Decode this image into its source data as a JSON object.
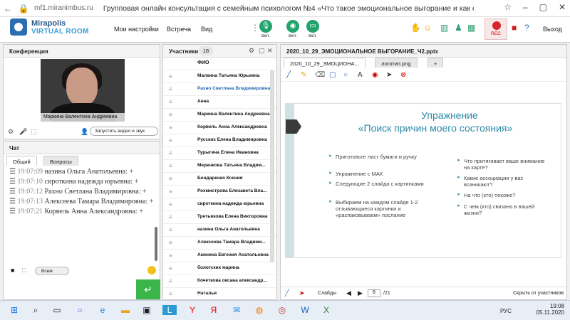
{
  "browser": {
    "url": "mf1.miranimbus.ru",
    "tab_title": "Групповая онлайн консультация с семейным психологом №4 «Что такое эмоциональное выгорание и как е..."
  },
  "app": {
    "logo_line1": "Mirapolis",
    "logo_line2": "VIRTUAL ROOM",
    "menu": [
      "Мои настройки",
      "Встреча",
      "Вид"
    ],
    "toggle_labels": [
      "вкл.",
      "вкл.",
      "вкл."
    ],
    "rec_label": "REC",
    "exit_label": "Выход"
  },
  "conference": {
    "title": "Конференция",
    "presenter_name": "Маркина Валентина Андреевна",
    "start_video_label": "Запустить видео и звук"
  },
  "chat": {
    "title": "Чат",
    "tabs": [
      "Общий",
      "Вопросы"
    ],
    "messages": [
      {
        "time": "19:07:09",
        "text": "назина Ольга Анатольевна: +"
      },
      {
        "time": "19:07:10",
        "text": "сироткина надежда юрьевна: +"
      },
      {
        "time": "19:07:12",
        "text": "Рахно Светлана Владимировна: +"
      },
      {
        "time": "19:07:13",
        "text": "Алексеева Тамара Владимировна: +"
      },
      {
        "time": "19:07:21",
        "text": "Корвель Анна Александровна: +"
      }
    ],
    "recipient": "Всем"
  },
  "participants": {
    "title": "Участники",
    "count": "18",
    "column_header": "ФИО",
    "list": [
      {
        "name": "Малкина Татьяна Юрьевна",
        "highlight": false
      },
      {
        "name": "Рахно Светлана Владимировна",
        "highlight": true
      },
      {
        "name": "Анна",
        "highlight": false
      },
      {
        "name": "Маркина Валентина Андреевна",
        "highlight": false
      },
      {
        "name": "Корвель Анна Александровна",
        "highlight": false
      },
      {
        "name": "Русских Елена Владимировна",
        "highlight": false
      },
      {
        "name": "Турыгина Елена Ивановна",
        "highlight": false
      },
      {
        "name": "Меренкова Татьяна Владим...",
        "highlight": false
      },
      {
        "name": "Бондаренко Ксения",
        "highlight": false
      },
      {
        "name": "Рохмистрова Елизавета Вла...",
        "highlight": false
      },
      {
        "name": "сироткина надежда юрьевна",
        "highlight": false
      },
      {
        "name": "Третьякова Елена Викторовна",
        "highlight": false
      },
      {
        "name": "назина Ольга Анатольевна",
        "highlight": false
      },
      {
        "name": "Алексеева Тамара Владими...",
        "highlight": false
      },
      {
        "name": "Акинина Евгения Анатольевна",
        "highlight": false
      },
      {
        "name": "болотских марина",
        "highlight": false
      },
      {
        "name": "Кочеткова оксана александр...",
        "highlight": false
      },
      {
        "name": "Наталья",
        "highlight": false
      }
    ]
  },
  "presentation": {
    "title": "2020_10_29_ЭМОЦИОНАЛЬНОЕ ВЫГОРАНИЕ_Ч2.pptx",
    "tabs": [
      "2020_10_29_ЭМОЦИОНА...",
      "логотип.png",
      "+"
    ],
    "slide": {
      "title1": "Упражнение",
      "title2": "«Поиск причин моего состояния»",
      "left_bullets": [
        "Приготовьте лист бумаги и ручку",
        "Упражнение с МАК",
        "Следующие 2 слайда с картинками",
        "Выбираем на каждом слайде 1-2 отзывающиеся картинки и «распаковываем» послание"
      ],
      "right_bullets": [
        "Что притягивает ваше внимание на карте?",
        "Какие ассоциации у вас возникают?",
        "На что (кто) похоже?",
        "С чем (кто) связано в вашей жизни?"
      ]
    },
    "slides_label": "Слайды",
    "current_slide": "8",
    "total_slides": "/21",
    "hide_label": "Скрыть от участников"
  },
  "taskbar": {
    "lang": "РУС",
    "time": "19:08",
    "date": "05.11.2020"
  }
}
